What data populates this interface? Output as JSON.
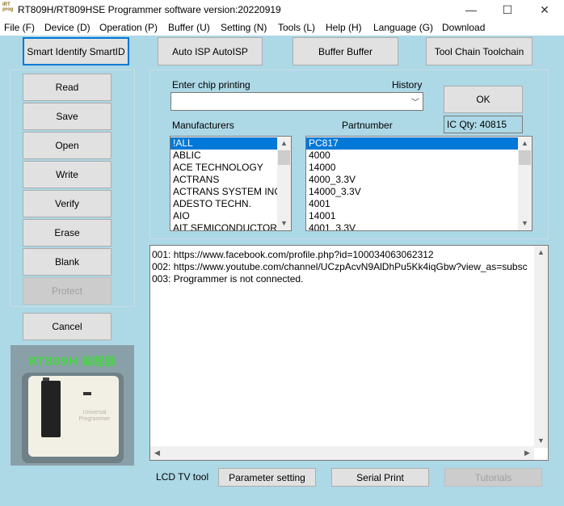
{
  "window": {
    "title": "RT809H/RT809HSE Programmer software version:20220919",
    "icon_text": "iRT prog",
    "minimize": "—",
    "maximize": "☐",
    "close": "✕"
  },
  "menu": [
    "File (F)",
    "Device (D)",
    "Operation (P)",
    "Buffer (U)",
    "Setting (N)",
    "Tools (L)",
    "Help (H)",
    "Language (G)",
    "Download"
  ],
  "top_buttons": {
    "smart_id": "Smart Identify SmartID",
    "auto_isp": "Auto ISP AutoISP",
    "buffer": "Buffer Buffer",
    "toolchain": "Tool Chain Toolchain"
  },
  "side_buttons": {
    "read": "Read",
    "save": "Save",
    "open": "Open",
    "write": "Write",
    "verify": "Verify",
    "erase": "Erase",
    "blank": "Blank",
    "protect": "Protect",
    "cancel": "Cancel"
  },
  "chip": {
    "enter_label": "Enter chip printing",
    "history_label": "History",
    "value": "",
    "ok": "OK",
    "manufacturers_label": "Manufacturers",
    "partnumber_label": "Partnumber",
    "ic_qty": "IC Qty: 40815",
    "manufacturers": [
      "!ALL",
      "ABLIC",
      "ACE TECHNOLOGY",
      "ACTRANS",
      "ACTRANS SYSTEM INC",
      "ADESTO TECHN.",
      "AIO",
      "AIT SEMICONDUCTOR"
    ],
    "partnumbers": [
      "PC817",
      "4000",
      "14000",
      "4000_3.3V",
      "14000_3.3V",
      "4001",
      "14001",
      "4001_3.3V"
    ]
  },
  "log": [
    "001:  https://www.facebook.com/profile.php?id=100034063062312",
    "002:  https://www.youtube.com/channel/UCzpAcvN9AlDhPu5Kk4iqGbw?view_as=subsc",
    "003:  Programmer is not connected."
  ],
  "bottom": {
    "lcd_label": "LCD TV tool",
    "parameter_setting": "Parameter setting",
    "serial_print": "Serial Print",
    "tutorials": "Tutorials"
  },
  "product": {
    "caption": "RT809H 编程器",
    "device_label": "Universal Programmer"
  }
}
